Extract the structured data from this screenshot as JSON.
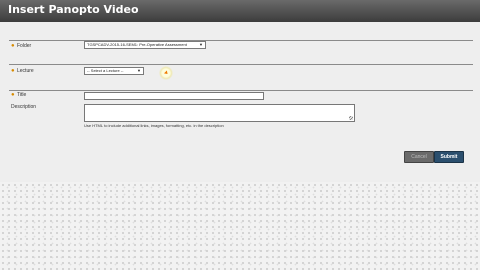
{
  "dialog": {
    "title": "Insert Panopto Video"
  },
  "form": {
    "folder": {
      "label": "Folder",
      "value": "TGSPCADV-2015-16-SEM1: Pre-Operative Assessment"
    },
    "lecture": {
      "label": "Lecture",
      "value": "-- Select a Lecture --"
    },
    "title": {
      "label": "Title",
      "value": ""
    },
    "description": {
      "label": "Description",
      "value": "",
      "hint": "Use HTML to include additional links, images, formatting, etc. in the description"
    }
  },
  "buttons": {
    "cancel": "Cancel",
    "submit": "Submit"
  },
  "colors": {
    "required_marker": "#d68a00",
    "submit_bg": "#2b4f6e",
    "title_bar": "#4a4a4a"
  }
}
